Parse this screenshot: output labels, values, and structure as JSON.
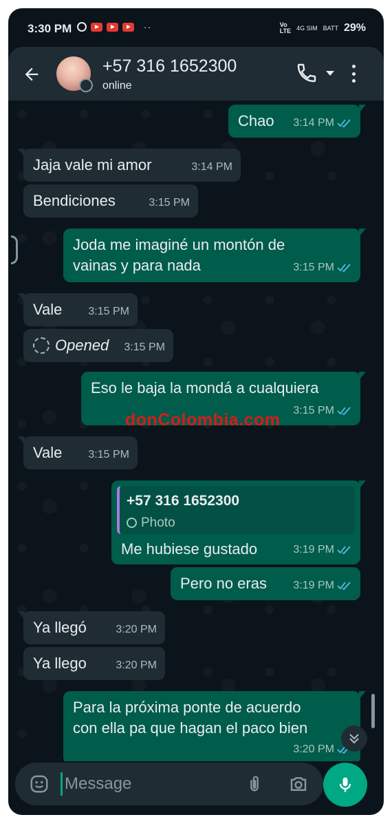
{
  "status_bar": {
    "time": "3:30 PM",
    "network_label_top": "Vo",
    "network_label_bottom": "LTE",
    "sim_label": "4G SIM",
    "battery_label": "BATT",
    "battery_percent": "29%"
  },
  "header": {
    "contact_name": "+57 316 1652300",
    "status": "online"
  },
  "messages": [
    {
      "text": "Chao",
      "time": "3:14 PM"
    },
    {
      "text": "Jaja vale mi amor",
      "time": "3:14 PM"
    },
    {
      "text": "Bendiciones",
      "time": "3:15 PM"
    },
    {
      "text_line1": "Joda me imaginé un montón de",
      "text_line2": "vainas y para nada",
      "time": "3:15 PM"
    },
    {
      "text": "Vale",
      "time": "3:15 PM"
    },
    {
      "text": "Opened",
      "time": "3:15 PM"
    },
    {
      "text": "Eso le baja la mondá a cualquiera",
      "time": "3:15 PM"
    },
    {
      "text": "Vale",
      "time": "3:15 PM"
    },
    {
      "quote_name": "+57 316 1652300",
      "quote_type": "Photo",
      "text": "Me hubiese gustado",
      "time": "3:19 PM"
    },
    {
      "text": "Pero no eras",
      "time": "3:19 PM"
    },
    {
      "text": "Ya llegó",
      "time": "3:20 PM"
    },
    {
      "text": "Ya llego",
      "time": "3:20 PM"
    },
    {
      "text_line1": "Para la próxima ponte de acuerdo",
      "text_line2": "con ella pa que hagan el paco bien",
      "time": "3:20 PM"
    }
  ],
  "watermark": {
    "text": "donColombia.com"
  },
  "composer": {
    "placeholder": "Message"
  },
  "colors": {
    "background": "#0b141a",
    "header": "#1f2c34",
    "outgoing_bubble": "#005c4b",
    "incoming_bubble": "#202c33",
    "accent": "#00a884",
    "read_ticks": "#53bdeb",
    "watermark": "#d81b1b"
  },
  "icons": [
    "back-arrow-icon",
    "call-icon",
    "more-vert-icon",
    "emoji-icon",
    "attach-icon",
    "camera-icon",
    "mic-icon",
    "double-chevron-down-icon",
    "read-ticks-icon"
  ]
}
